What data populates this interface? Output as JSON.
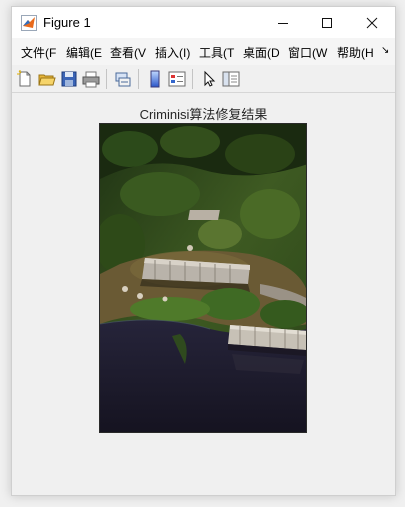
{
  "window": {
    "title": "Figure 1",
    "controls": {
      "minimize": "minimize-icon",
      "maximize": "maximize-icon",
      "close": "close-icon"
    }
  },
  "menubar": {
    "items": [
      {
        "label": "文件(F"
      },
      {
        "label": "编辑(E"
      },
      {
        "label": "查看(V"
      },
      {
        "label": "插入(I)"
      },
      {
        "label": "工具(T"
      },
      {
        "label": "桌面(D"
      },
      {
        "label": "窗口(W"
      },
      {
        "label": "帮助(H"
      }
    ],
    "overflow": "↘"
  },
  "toolbar": {
    "tools": [
      "new-figure-icon",
      "open-file-icon",
      "save-icon",
      "print-icon",
      "link-plot-icon",
      "insert-colorbar-icon",
      "insert-legend-icon",
      "edit-plot-arrow-icon",
      "property-inspector-icon"
    ]
  },
  "figure": {
    "axes_title": "Criminisi算法修复结果",
    "image_content": "aerial photo of a jungle village with huts, trees and a river",
    "colors": {
      "water": "#1d1b2a",
      "jungle": "#2f4a1e",
      "roof": "#b9b3aa"
    }
  }
}
